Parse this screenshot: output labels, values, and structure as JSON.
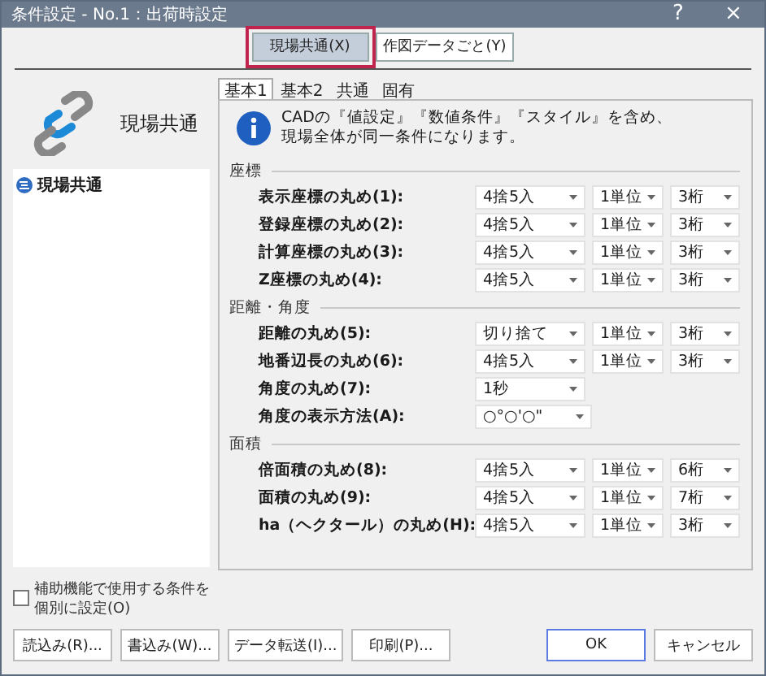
{
  "window": {
    "title": "条件設定 - No.1：出荷時設定",
    "help": "?",
    "close": "×"
  },
  "top_tabs": [
    {
      "label": "現場共通(X)",
      "selected": true
    },
    {
      "label": "作図データごと(Y)",
      "selected": false
    }
  ],
  "left": {
    "title": "現場共通",
    "tree": [
      {
        "label": "現場共通",
        "selected": false
      }
    ],
    "checkbox": {
      "label": "補助機能で使用する条件を個別に設定(O)",
      "checked": false
    }
  },
  "sub_tabs": [
    {
      "label": "基本1",
      "selected": true
    },
    {
      "label": "基本2",
      "selected": false
    },
    {
      "label": "共通",
      "selected": false
    },
    {
      "label": "固有",
      "selected": false
    }
  ],
  "info": [
    "CADの『値設定』『数値条件』『スタイル』を含め、",
    "現場全体が同一条件になります。"
  ],
  "sections": [
    {
      "title": "座標",
      "rows": [
        {
          "label": "表示座標の丸め(1):",
          "selects": [
            "4捨5入",
            "1単位",
            "3桁"
          ]
        },
        {
          "label": "登録座標の丸め(2):",
          "selects": [
            "4捨5入",
            "1単位",
            "3桁"
          ]
        },
        {
          "label": "計算座標の丸め(3):",
          "selects": [
            "4捨5入",
            "1単位",
            "3桁"
          ]
        },
        {
          "label": "Z座標の丸め(4):",
          "selects": [
            "4捨5入",
            "1単位",
            "3桁"
          ]
        }
      ]
    },
    {
      "title": "距離・角度",
      "rows": [
        {
          "label": "距離の丸め(5):",
          "selects": [
            "切り捨て",
            "1単位",
            "3桁"
          ]
        },
        {
          "label": "地番辺長の丸め(6):",
          "selects": [
            "4捨5入",
            "1単位",
            "3桁"
          ]
        },
        {
          "label": "角度の丸め(7):",
          "selects": [
            "1秒"
          ]
        },
        {
          "label": "角度の表示方法(A):",
          "selects": [
            "○°○'○\""
          ]
        }
      ]
    },
    {
      "title": "面積",
      "rows": [
        {
          "label": "倍面積の丸め(8):",
          "selects": [
            "4捨5入",
            "1単位",
            "6桁"
          ]
        },
        {
          "label": "面積の丸め(9):",
          "selects": [
            "4捨5入",
            "1単位",
            "7桁"
          ]
        },
        {
          "label": "ha（ヘクタール）の丸め(H):",
          "selects": [
            "4捨5入",
            "1単位",
            "3桁"
          ]
        }
      ]
    }
  ],
  "buttons_left": [
    "読込み(R)...",
    "書込み(W)...",
    "データ転送(I)...",
    "印刷(P)..."
  ],
  "buttons_right": [
    {
      "label": "OK",
      "default": true
    },
    {
      "label": "キャンセル",
      "default": false
    }
  ]
}
